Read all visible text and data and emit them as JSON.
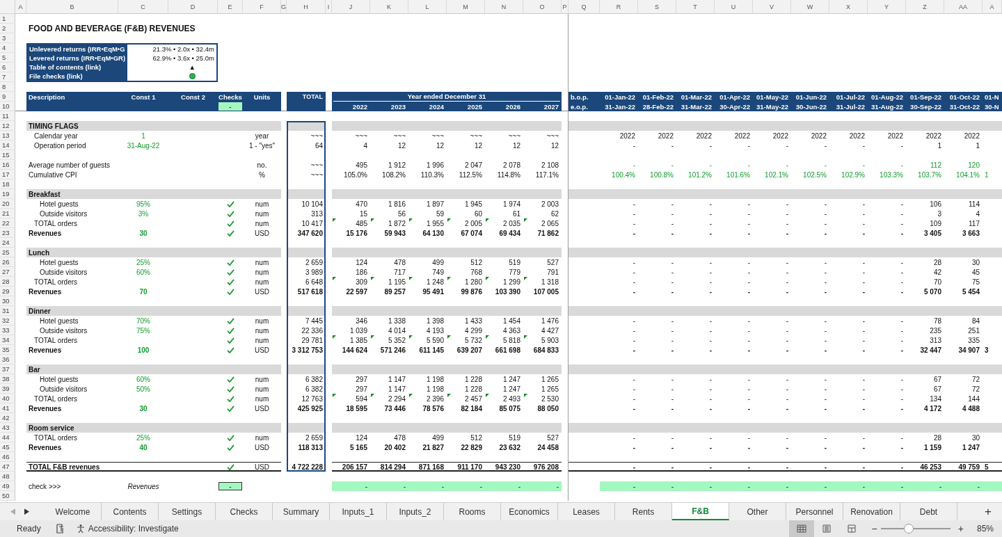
{
  "column_headers": [
    "A",
    "B",
    "C",
    "D",
    "E",
    "F",
    "G",
    "H",
    "I",
    "J",
    "K",
    "L",
    "M",
    "N",
    "O",
    "P",
    "Q",
    "R",
    "S",
    "T",
    "U",
    "V",
    "W",
    "X",
    "Y",
    "Z",
    "AA",
    "A"
  ],
  "rows": [
    {
      "number": "1",
      "kind": "blank"
    },
    {
      "number": "2",
      "kind": "title",
      "label": "FOOD AND BEVERAGE (F&B) REVENUES"
    },
    {
      "number": "3",
      "kind": "blank"
    },
    {
      "number": "4",
      "kind": "summary_text",
      "label": "Unlevered returns (IRR•EqM•G",
      "value": "21.3% • 2.0x • 32.4m"
    },
    {
      "number": "5",
      "kind": "summary_text",
      "label": "Levered returns (IRR•EqM•GR)",
      "value": "62.9% • 3.6x • 25.0m"
    },
    {
      "number": "6",
      "kind": "summary_link",
      "label": "Table of contents (link)",
      "value": "▲"
    },
    {
      "number": "7",
      "kind": "summary_status",
      "label": "File checks (link)",
      "color": "#2bb24c"
    },
    {
      "number": "8",
      "kind": "blank"
    },
    {
      "number": "9",
      "kind": "header_top",
      "columns": [
        "Description",
        "Const 1",
        "Const 2",
        "Checks",
        "Units"
      ],
      "total": "TOTAL",
      "caption": "Year ended December 31",
      "period": "b.o.p.",
      "months": [
        "01-Jan-22",
        "01-Feb-22",
        "01-Mar-22",
        "01-Apr-22",
        "01-May-22",
        "01-Jun-22",
        "01-Jul-22",
        "01-Aug-22",
        "01-Sep-22",
        "01-Oct-22"
      ],
      "partial": "01-N"
    },
    {
      "number": "10",
      "kind": "header_bottom",
      "checks": "-",
      "years": [
        "2022",
        "2023",
        "2024",
        "2025",
        "2026",
        "2027"
      ],
      "period": "e.o.p.",
      "months": [
        "31-Jan-22",
        "28-Feb-22",
        "31-Mar-22",
        "30-Apr-22",
        "31-May-22",
        "30-Jun-22",
        "31-Jul-22",
        "31-Aug-22",
        "30-Sep-22",
        "31-Oct-22"
      ],
      "partial": "30-N"
    },
    {
      "number": "11",
      "kind": "blank"
    },
    {
      "number": "12",
      "kind": "section",
      "label": "TIMING FLAGS"
    },
    {
      "number": "13",
      "kind": "flag",
      "label": "Calendar year",
      "const1": "1",
      "checked": false,
      "unit": "year",
      "total": "~~~",
      "flagged": false,
      "months_green": false,
      "years": [
        "~~~",
        "~~~",
        "~~~",
        "~~~",
        "~~~",
        "~~~"
      ],
      "months": [
        "2022",
        "2022",
        "2022",
        "2022",
        "2022",
        "2022",
        "2022",
        "2022",
        "2022",
        "2022"
      ]
    },
    {
      "number": "14",
      "kind": "flag",
      "label": "Operation period",
      "const1": "31-Aug-22",
      "checked": false,
      "unit": "1 - \"yes\"",
      "total": "64",
      "flagged": false,
      "months_green": false,
      "years": [
        "4",
        "12",
        "12",
        "12",
        "12",
        "12"
      ],
      "months": [
        "-",
        "-",
        "-",
        "-",
        "-",
        "-",
        "-",
        "-",
        "1",
        "1"
      ]
    },
    {
      "number": "15",
      "kind": "blank"
    },
    {
      "number": "16",
      "kind": "metric",
      "label": "Average number of guests",
      "checked": false,
      "unit": "no.",
      "total": "~~~",
      "flagged": false,
      "months_green": true,
      "years": [
        "495",
        "1 912",
        "1 996",
        "2 047",
        "2 078",
        "2 108"
      ],
      "months": [
        "-",
        "-",
        "-",
        "-",
        "-",
        "-",
        "-",
        "-",
        "112",
        "120"
      ]
    },
    {
      "number": "17",
      "kind": "metric",
      "label": "Cumulative CPI",
      "checked": false,
      "unit": "%",
      "total": "~~~",
      "flagged": false,
      "months_green": true,
      "years": [
        "105.0%",
        "108.2%",
        "110.3%",
        "112.5%",
        "114.8%",
        "117.1%"
      ],
      "months": [
        "100.4%",
        "100.8%",
        "101.2%",
        "101.6%",
        "102.1%",
        "102.5%",
        "102.9%",
        "103.3%",
        "103.7%",
        "104.1%"
      ],
      "partial": "1"
    },
    {
      "number": "18",
      "kind": "blank"
    },
    {
      "number": "19",
      "kind": "section",
      "label": "Breakfast"
    },
    {
      "number": "20",
      "kind": "item",
      "label": "Hotel guests",
      "const1": "95%",
      "checked": true,
      "unit": "num",
      "total": "10 104",
      "flagged": false,
      "months_green": false,
      "years": [
        "470",
        "1 816",
        "1 897",
        "1 945",
        "1 974",
        "2 003"
      ],
      "months": [
        "-",
        "-",
        "-",
        "-",
        "-",
        "-",
        "-",
        "-",
        "106",
        "114"
      ]
    },
    {
      "number": "21",
      "kind": "item",
      "label": "Outside visitors",
      "const1": "3%",
      "checked": true,
      "unit": "num",
      "total": "313",
      "flagged": false,
      "months_green": false,
      "years": [
        "15",
        "56",
        "59",
        "60",
        "61",
        "62"
      ],
      "months": [
        "-",
        "-",
        "-",
        "-",
        "-",
        "-",
        "-",
        "-",
        "3",
        "4"
      ]
    },
    {
      "number": "22",
      "kind": "subtotal",
      "label": "TOTAL orders",
      "checked": true,
      "unit": "num",
      "total": "10 417",
      "flagged": true,
      "months_green": false,
      "years": [
        "485",
        "1 872",
        "1 955",
        "2 005",
        "2 035",
        "2 065"
      ],
      "months": [
        "-",
        "-",
        "-",
        "-",
        "-",
        "-",
        "-",
        "-",
        "109",
        "117"
      ]
    },
    {
      "number": "23",
      "kind": "revenue",
      "label": "Revenues",
      "const1": "30",
      "checked": true,
      "unit": "USD",
      "total": "347 620",
      "flagged": false,
      "months_green": false,
      "years": [
        "15 176",
        "59 943",
        "64 130",
        "67 074",
        "69 434",
        "71 862"
      ],
      "months": [
        "-",
        "-",
        "-",
        "-",
        "-",
        "-",
        "-",
        "-",
        "3 405",
        "3 663"
      ]
    },
    {
      "number": "24",
      "kind": "blank"
    },
    {
      "number": "25",
      "kind": "section",
      "label": "Lunch"
    },
    {
      "number": "26",
      "kind": "item",
      "label": "Hotel guests",
      "const1": "25%",
      "checked": true,
      "unit": "num",
      "total": "2 659",
      "flagged": false,
      "months_green": false,
      "years": [
        "124",
        "478",
        "499",
        "512",
        "519",
        "527"
      ],
      "months": [
        "-",
        "-",
        "-",
        "-",
        "-",
        "-",
        "-",
        "-",
        "28",
        "30"
      ]
    },
    {
      "number": "27",
      "kind": "item",
      "label": "Outside visitors",
      "const1": "60%",
      "checked": true,
      "unit": "num",
      "total": "3 989",
      "flagged": false,
      "months_green": false,
      "years": [
        "186",
        "717",
        "749",
        "768",
        "779",
        "791"
      ],
      "months": [
        "-",
        "-",
        "-",
        "-",
        "-",
        "-",
        "-",
        "-",
        "42",
        "45"
      ]
    },
    {
      "number": "28",
      "kind": "subtotal",
      "label": "TOTAL orders",
      "checked": true,
      "unit": "num",
      "total": "6 648",
      "flagged": true,
      "months_green": false,
      "years": [
        "309",
        "1 195",
        "1 248",
        "1 280",
        "1 299",
        "1 318"
      ],
      "months": [
        "-",
        "-",
        "-",
        "-",
        "-",
        "-",
        "-",
        "-",
        "70",
        "75"
      ]
    },
    {
      "number": "29",
      "kind": "revenue",
      "label": "Revenues",
      "const1": "70",
      "checked": true,
      "unit": "USD",
      "total": "517 618",
      "flagged": false,
      "months_green": false,
      "years": [
        "22 597",
        "89 257",
        "95 491",
        "99 876",
        "103 390",
        "107 005"
      ],
      "months": [
        "-",
        "-",
        "-",
        "-",
        "-",
        "-",
        "-",
        "-",
        "5 070",
        "5 454"
      ]
    },
    {
      "number": "30",
      "kind": "blank"
    },
    {
      "number": "31",
      "kind": "section",
      "label": "Dinner"
    },
    {
      "number": "32",
      "kind": "item",
      "label": "Hotel guests",
      "const1": "70%",
      "checked": true,
      "unit": "num",
      "total": "7 445",
      "flagged": false,
      "months_green": false,
      "years": [
        "346",
        "1 338",
        "1 398",
        "1 433",
        "1 454",
        "1 476"
      ],
      "months": [
        "-",
        "-",
        "-",
        "-",
        "-",
        "-",
        "-",
        "-",
        "78",
        "84"
      ]
    },
    {
      "number": "33",
      "kind": "item",
      "label": "Outside visitors",
      "const1": "75%",
      "checked": true,
      "unit": "num",
      "total": "22 336",
      "flagged": false,
      "months_green": false,
      "years": [
        "1 039",
        "4 014",
        "4 193",
        "4 299",
        "4 363",
        "4 427"
      ],
      "months": [
        "-",
        "-",
        "-",
        "-",
        "-",
        "-",
        "-",
        "-",
        "235",
        "251"
      ]
    },
    {
      "number": "34",
      "kind": "subtotal",
      "label": "TOTAL orders",
      "checked": true,
      "unit": "num",
      "total": "29 781",
      "flagged": true,
      "months_green": false,
      "years": [
        "1 385",
        "5 352",
        "5 590",
        "5 732",
        "5 818",
        "5 903"
      ],
      "months": [
        "-",
        "-",
        "-",
        "-",
        "-",
        "-",
        "-",
        "-",
        "313",
        "335"
      ]
    },
    {
      "number": "35",
      "kind": "revenue",
      "label": "Revenues",
      "const1": "100",
      "checked": true,
      "unit": "USD",
      "total": "3 312 753",
      "flagged": false,
      "months_green": false,
      "years": [
        "144 624",
        "571 246",
        "611 145",
        "639 207",
        "661 698",
        "684 833"
      ],
      "months": [
        "-",
        "-",
        "-",
        "-",
        "-",
        "-",
        "-",
        "-",
        "32 447",
        "34 907"
      ],
      "partial": "3"
    },
    {
      "number": "36",
      "kind": "blank"
    },
    {
      "number": "37",
      "kind": "section",
      "label": "Bar"
    },
    {
      "number": "38",
      "kind": "item",
      "label": "Hotel guests",
      "const1": "60%",
      "checked": true,
      "unit": "num",
      "total": "6 382",
      "flagged": false,
      "months_green": false,
      "years": [
        "297",
        "1 147",
        "1 198",
        "1 228",
        "1 247",
        "1 265"
      ],
      "months": [
        "-",
        "-",
        "-",
        "-",
        "-",
        "-",
        "-",
        "-",
        "67",
        "72"
      ]
    },
    {
      "number": "39",
      "kind": "item",
      "label": "Outside visitors",
      "const1": "50%",
      "checked": true,
      "unit": "num",
      "total": "6 382",
      "flagged": false,
      "months_green": false,
      "years": [
        "297",
        "1 147",
        "1 198",
        "1 228",
        "1 247",
        "1 265"
      ],
      "months": [
        "-",
        "-",
        "-",
        "-",
        "-",
        "-",
        "-",
        "-",
        "67",
        "72"
      ]
    },
    {
      "number": "40",
      "kind": "subtotal",
      "label": "TOTAL orders",
      "checked": true,
      "unit": "num",
      "total": "12 763",
      "flagged": true,
      "months_green": false,
      "years": [
        "594",
        "2 294",
        "2 396",
        "2 457",
        "2 493",
        "2 530"
      ],
      "months": [
        "-",
        "-",
        "-",
        "-",
        "-",
        "-",
        "-",
        "-",
        "134",
        "144"
      ]
    },
    {
      "number": "41",
      "kind": "revenue",
      "label": "Revenues",
      "const1": "30",
      "checked": true,
      "unit": "USD",
      "total": "425 925",
      "flagged": false,
      "months_green": false,
      "years": [
        "18 595",
        "73 446",
        "78 576",
        "82 184",
        "85 075",
        "88 050"
      ],
      "months": [
        "-",
        "-",
        "-",
        "-",
        "-",
        "-",
        "-",
        "-",
        "4 172",
        "4 488"
      ]
    },
    {
      "number": "42",
      "kind": "blank"
    },
    {
      "number": "43",
      "kind": "section",
      "label": "Room service"
    },
    {
      "number": "44",
      "kind": "subtotal",
      "label": "TOTAL orders",
      "const1": "25%",
      "checked": true,
      "unit": "num",
      "total": "2 659",
      "flagged": false,
      "months_green": false,
      "years": [
        "124",
        "478",
        "499",
        "512",
        "519",
        "527"
      ],
      "months": [
        "-",
        "-",
        "-",
        "-",
        "-",
        "-",
        "-",
        "-",
        "28",
        "30"
      ]
    },
    {
      "number": "45",
      "kind": "revenue",
      "label": "Revenues",
      "const1": "40",
      "checked": true,
      "unit": "USD",
      "total": "118 313",
      "flagged": false,
      "months_green": false,
      "years": [
        "5 165",
        "20 402",
        "21 827",
        "22 829",
        "23 632",
        "24 458"
      ],
      "months": [
        "-",
        "-",
        "-",
        "-",
        "-",
        "-",
        "-",
        "-",
        "1 159",
        "1 247"
      ]
    },
    {
      "number": "46",
      "kind": "blank"
    },
    {
      "number": "47",
      "kind": "grand_total",
      "label": "TOTAL F&B revenues",
      "checked": true,
      "unit": "USD",
      "total": "4 722 228",
      "flagged": false,
      "months_green": false,
      "years": [
        "206 157",
        "814 294",
        "871 168",
        "911 170",
        "943 230",
        "976 208"
      ],
      "months": [
        "-",
        "-",
        "-",
        "-",
        "-",
        "-",
        "-",
        "-",
        "46 253",
        "49 759"
      ],
      "partial": "5"
    },
    {
      "number": "48",
      "kind": "blank"
    },
    {
      "number": "49",
      "kind": "check",
      "label": "check >>>",
      "caption": "Revenues",
      "checks": "-",
      "years": [
        "-",
        "-",
        "-",
        "-",
        "-",
        "-"
      ],
      "months": [
        "-",
        "-",
        "-",
        "-",
        "-",
        "-",
        "-",
        "-",
        "-",
        "-"
      ]
    },
    {
      "number": "50",
      "kind": "blank"
    }
  ],
  "sheet_tabs": [
    {
      "label": "Welcome",
      "selected": false
    },
    {
      "label": "Contents",
      "selected": false
    },
    {
      "label": "Settings",
      "selected": false
    },
    {
      "label": "Checks",
      "selected": false
    },
    {
      "label": "Summary",
      "selected": false
    },
    {
      "label": "Inputs_1",
      "selected": false
    },
    {
      "label": "Inputs_2",
      "selected": false
    },
    {
      "label": "Rooms",
      "selected": false
    },
    {
      "label": "Economics",
      "selected": false
    },
    {
      "label": "Leases",
      "selected": false
    },
    {
      "label": "Rents",
      "selected": false
    },
    {
      "label": "F&B",
      "selected": true
    },
    {
      "label": "Other",
      "selected": false
    },
    {
      "label": "Personnel",
      "selected": false
    },
    {
      "label": "Renovation",
      "selected": false
    },
    {
      "label": "Debt",
      "selected": false
    }
  ],
  "add_sheet": "+",
  "status_bar": {
    "status": "Ready",
    "accessibility": "Accessibility: Investigate",
    "views": [
      {
        "kind": "normal",
        "selected": true
      },
      {
        "kind": "page_layout",
        "selected": false
      },
      {
        "kind": "page_break",
        "selected": false
      }
    ],
    "zoom_out": "−",
    "zoom_in": "+",
    "zoom": {
      "level": 0.4
    },
    "zoom_label": "85%"
  }
}
